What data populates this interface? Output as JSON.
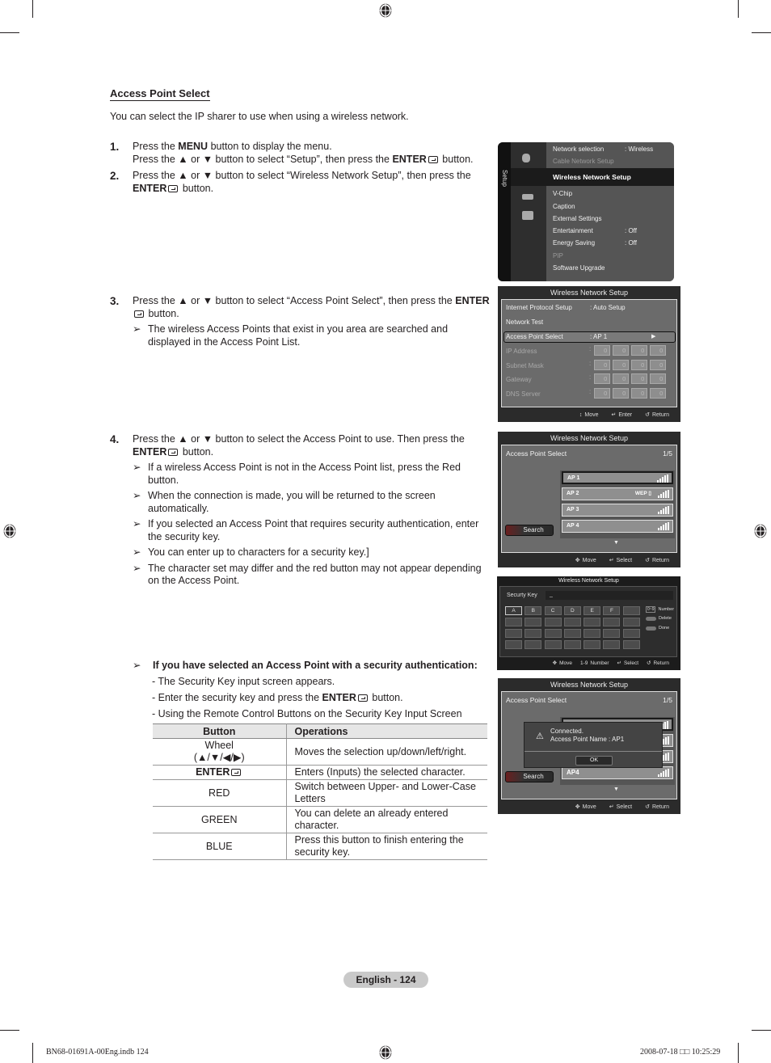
{
  "section": {
    "title": "Access Point Select",
    "intro": "You can select the IP sharer to use when using a wireless network."
  },
  "steps": [
    {
      "num": "1.",
      "lines": [
        [
          "Press the ",
          {
            "b": "MENU"
          },
          " button to display the menu."
        ],
        [
          "Press the ▲ or ▼ button to select “Setup”, then press the ",
          {
            "b": "ENTER"
          },
          {
            "icon": "enter"
          },
          " button."
        ]
      ],
      "notes": []
    },
    {
      "num": "2.",
      "lines": [
        [
          "Press the ▲ or ▼ button to select “Wireless Network Setup”, then press the ",
          {
            "b": "ENTER"
          },
          {
            "icon": "enter"
          },
          " button."
        ]
      ],
      "notes": []
    },
    {
      "num": "3.",
      "lines": [
        [
          "Press the ▲ or ▼ button to select “Access Point Select”, then press the ",
          {
            "b": "ENTER"
          },
          {
            "icon": "enter"
          },
          " button."
        ]
      ],
      "notes": [
        "The wireless Access Points that exist in you area are searched and displayed in the Access Point List."
      ]
    },
    {
      "num": "4.",
      "lines": [
        [
          "Press the ▲ or ▼ button to select the Access Point to use. Then press the ",
          {
            "b": "ENTER"
          },
          {
            "icon": "enter"
          },
          " button."
        ]
      ],
      "notes": [
        "If a wireless Access Point is not in the Access Point list, press the Red button.",
        "When the connection is made, you will be returned to the screen automatically.",
        "If you selected an Access Point that requires security authentication, enter the security key.",
        "You can enter up to characters for a security key.]",
        "The character set may differ and the red button may not appear depending on the Access Point."
      ]
    }
  ],
  "note_arrow": "➢",
  "auth": {
    "heading": "If you have selected an Access Point with a security authentication:",
    "items": [
      [
        "- The Security Key input screen appears."
      ],
      [
        "- Enter the security key and press the ",
        {
          "b": "ENTER"
        },
        {
          "icon": "enter"
        },
        " button."
      ],
      [
        "- Using the Remote Control Buttons on the Security Key Input Screen"
      ]
    ]
  },
  "ops_table": {
    "headers": [
      "Button",
      "Operations"
    ],
    "rows": [
      {
        "button": "Wheel\n(▲/▼/◀/▶)",
        "op": "Moves the selection up/down/left/right."
      },
      {
        "button": "ENTER",
        "bold": true,
        "icon": true,
        "op": "Enters (Inputs) the selected character."
      },
      {
        "button": "RED",
        "op": "Switch between Upper- and Lower-Case Letters"
      },
      {
        "button": "GREEN",
        "op": "You can delete an already entered character."
      },
      {
        "button": "BLUE",
        "op": "Press this button to finish entering the security key."
      }
    ]
  },
  "screen_setup": {
    "side_label": "Setup",
    "items": [
      {
        "label": "Network selection",
        "value": ": Wireless",
        "dim": false
      },
      {
        "label": "Cable Network Setup",
        "value": "",
        "dim": true
      },
      {
        "label": "Wireless Network Setup",
        "value": "",
        "selected": true
      },
      {
        "label": "V-Chip",
        "value": ""
      },
      {
        "label": "Caption",
        "value": ""
      },
      {
        "label": "External Settings",
        "value": ""
      },
      {
        "label": "Entertainment",
        "value": ": Off"
      },
      {
        "label": "Energy Saving",
        "value": ": Off"
      },
      {
        "label": "PIP",
        "value": "",
        "dim": true
      },
      {
        "label": "Software Upgrade",
        "value": ""
      }
    ]
  },
  "screen_wns": {
    "title": "Wireless Network Setup",
    "rows": [
      {
        "label": "Internet Protocol Setup",
        "value": ": Auto Setup"
      },
      {
        "label": "Network Test",
        "value": ""
      },
      {
        "label": "Access Point Select",
        "value": ": AP 1",
        "selected": true,
        "arrow": "▶"
      },
      {
        "label": "IP Address",
        "boxes": [
          "0",
          "0",
          "0",
          "0"
        ],
        "dim": true
      },
      {
        "label": "Subnet Mask",
        "boxes": [
          "0",
          "0",
          "0",
          "0"
        ],
        "dim": true
      },
      {
        "label": "Gateway",
        "boxes": [
          "0",
          "0",
          "0",
          "0"
        ],
        "dim": true
      },
      {
        "label": "DNS Server",
        "boxes": [
          "0",
          "0",
          "0",
          "0"
        ],
        "dim": true
      }
    ],
    "footer": [
      {
        "icon": "updown-icon",
        "glyph": "↕",
        "label": "Move"
      },
      {
        "icon": "enter-icon",
        "glyph": "↵",
        "label": "Enter"
      },
      {
        "icon": "return-icon",
        "glyph": "↺",
        "label": "Return"
      }
    ]
  },
  "screen_ap": {
    "title": "Wireless Network Setup",
    "label": "Access Point Select",
    "count": "1/5",
    "items": [
      {
        "name": "AP 1",
        "security": "",
        "signal": 4,
        "selected": true
      },
      {
        "name": "AP 2",
        "security": "WEP",
        "signal": 4
      },
      {
        "name": "AP 3",
        "security": "",
        "signal": 4
      },
      {
        "name": "AP 4",
        "security": "",
        "signal": 4
      }
    ],
    "search_label": "Search",
    "more_glyph": "▼",
    "footer": [
      {
        "icon": "move-icon",
        "glyph": "✥",
        "label": "Move"
      },
      {
        "icon": "enter-icon",
        "glyph": "↵",
        "label": "Select"
      },
      {
        "icon": "return-icon",
        "glyph": "↺",
        "label": "Return"
      }
    ]
  },
  "screen_key": {
    "title": "Wireless Network Setup",
    "key_label": "Securty Key",
    "key_value": "_",
    "keys": [
      "A",
      "B",
      "C",
      "D",
      "E",
      "F",
      "",
      "",
      "",
      "",
      "",
      "",
      "",
      "",
      "",
      "",
      "",
      "",
      "",
      "",
      "",
      "",
      "",
      "",
      "",
      "",
      "",
      "",
      ""
    ],
    "legend": [
      {
        "chip": "0~9",
        "label": "Number"
      },
      {
        "pill": true,
        "label": "Delete"
      },
      {
        "pill": true,
        "label": "Done"
      }
    ],
    "footer": [
      {
        "icon": "move-icon",
        "glyph": "✥",
        "label": "Move"
      },
      {
        "icon": "number-icon",
        "glyph": "1-9",
        "label": "Number"
      },
      {
        "icon": "enter-icon",
        "glyph": "↵",
        "label": "Select"
      },
      {
        "icon": "return-icon",
        "glyph": "↺",
        "label": "Return"
      }
    ]
  },
  "screen_connected": {
    "title": "Wireless Network Setup",
    "label": "Access Point Select",
    "count": "1/5",
    "popup_lines": [
      "Connected.",
      "Access Point Name : AP1"
    ],
    "ok_label": "OK",
    "last_item": "AP4",
    "search_label": "Search",
    "more_glyph": "▼",
    "footer": [
      {
        "icon": "move-icon",
        "glyph": "✥",
        "label": "Move"
      },
      {
        "icon": "enter-icon",
        "glyph": "↵",
        "label": "Select"
      },
      {
        "icon": "return-icon",
        "glyph": "↺",
        "label": "Return"
      }
    ]
  },
  "page": {
    "badge": "English - 124",
    "footer_left": "BN68-01691A-00Eng.indb   124",
    "footer_right": "2008-07-18   □□ 10:25:29"
  }
}
